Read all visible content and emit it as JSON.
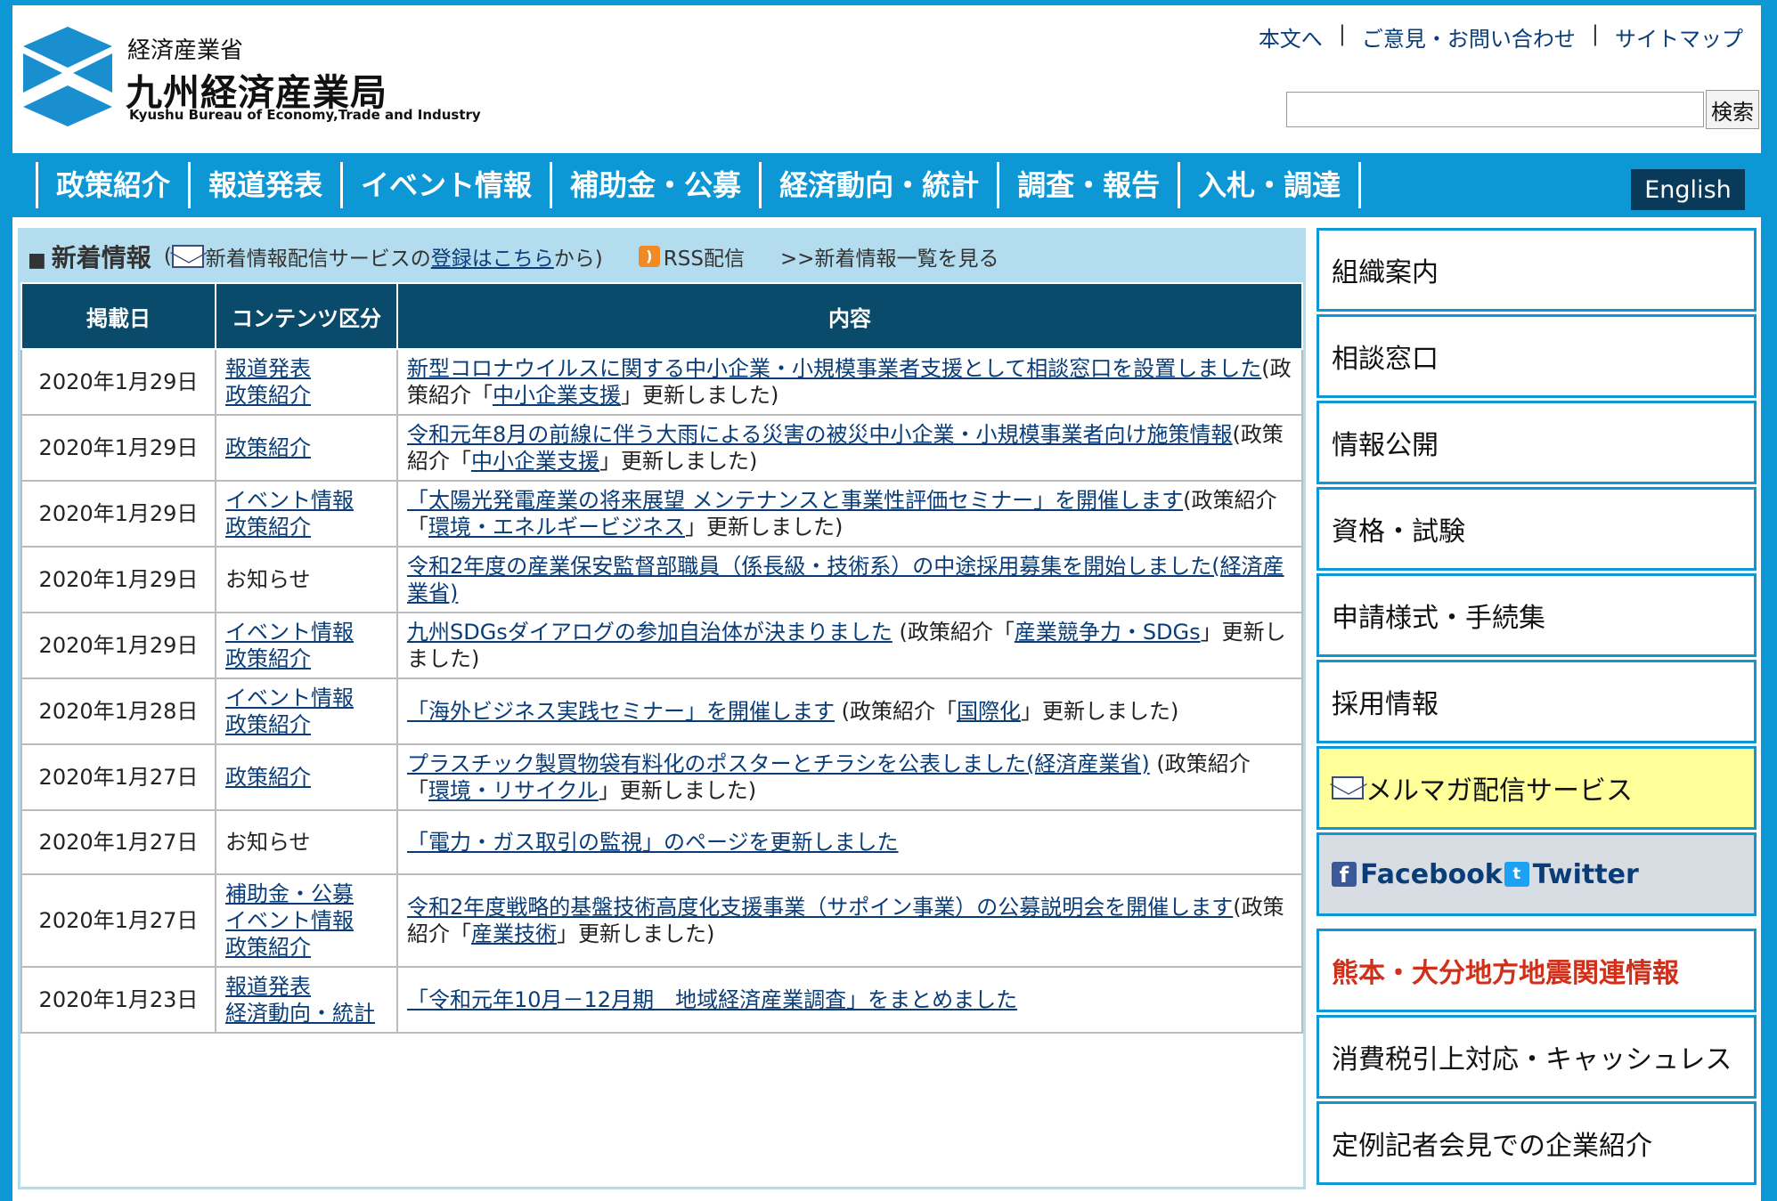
{
  "header": {
    "ministry": "経済産業省",
    "bureau": "九州経済産業局",
    "bureau_en": "Kyushu Bureau of Economy,Trade and Industry",
    "util_links": [
      "本文へ",
      "ご意見・お問い合わせ",
      "サイトマップ"
    ],
    "search_button": "検索",
    "search_value": ""
  },
  "nav": {
    "items": [
      "政策紹介",
      "報道発表",
      "イベント情報",
      "補助金・公募",
      "経済動向・統計",
      "調査・報告",
      "入札・調達"
    ],
    "english": "English"
  },
  "news": {
    "title": "新着情報",
    "sub_prefix": "(",
    "sub_text": "新着情報配信サービスの",
    "sub_link": "登録はこちら",
    "sub_suffix": "から)",
    "rss_label": "RSS配信",
    "list_link": ">>新着情報一覧を見る",
    "columns": [
      "掲載日",
      "コンテンツ区分",
      "内容"
    ],
    "rows": [
      {
        "date": "2020年1月29日",
        "cats": [
          "報道発表",
          "政策紹介"
        ],
        "link": "新型コロナウイルスに関する中小企業・小規模事業者支援として相談窓口を設置しました",
        "pre": "(政策紹介「",
        "sublink": "中小企業支援",
        "post": "」更新しました)"
      },
      {
        "date": "2020年1月29日",
        "cats": [
          "政策紹介"
        ],
        "link": "令和元年8月の前線に伴う大雨による災害の被災中小企業・小規模事業者向け施策情報",
        "pre": "(政策紹介「",
        "sublink": "中小企業支援",
        "post": "」更新しました)"
      },
      {
        "date": "2020年1月29日",
        "cats": [
          "イベント情報",
          "政策紹介"
        ],
        "link": "「太陽光発電産業の将来展望 メンテナンスと事業性評価セミナー」を開催します",
        "pre": "(政策紹介「",
        "sublink": "環境・エネルギービジネス",
        "post": "」更新しました)"
      },
      {
        "date": "2020年1月29日",
        "cats_text": "お知らせ",
        "link": "令和2年度の産業保安監督部職員（係長級・技術系）の中途採用募集を開始しました(経済産業省)"
      },
      {
        "date": "2020年1月29日",
        "cats": [
          "イベント情報",
          "政策紹介"
        ],
        "link": "九州SDGsダイアログの参加自治体が決まりました",
        "pre": " (政策紹介「",
        "sublink": "産業競争力・SDGs",
        "post": "」更新しました)"
      },
      {
        "date": "2020年1月28日",
        "cats": [
          "イベント情報",
          "政策紹介"
        ],
        "link": "「海外ビジネス実践セミナー」を開催します",
        "pre": " (政策紹介「",
        "sublink": "国際化",
        "post": "」更新しました)"
      },
      {
        "date": "2020年1月27日",
        "cats": [
          "政策紹介"
        ],
        "link": "プラスチック製買物袋有料化のポスターとチラシを公表しました(経済産業省)",
        "pre": " (政策紹介「",
        "sublink": "環境・リサイクル",
        "post": "」更新しました)"
      },
      {
        "date": "2020年1月27日",
        "cats_text": "お知らせ",
        "link": "「電力・ガス取引の監視」のページを更新しました"
      },
      {
        "date": "2020年1月27日",
        "cats": [
          "補助金・公募",
          "イベント情報",
          "政策紹介"
        ],
        "link": "令和2年度戦略的基盤技術高度化支援事業（サポイン事業）の公募説明会を開催します",
        "pre": "(政策紹介「",
        "sublink": "産業技術",
        "post": "」更新しました)"
      },
      {
        "date": "2020年1月23日",
        "cats": [
          "報道発表",
          "経済動向・統計"
        ],
        "link": "「令和元年10月－12月期　地域経済産業調査」をまとめました"
      }
    ]
  },
  "sidebar": {
    "items": [
      "組織案内",
      "相談窓口",
      "情報公開",
      "資格・試験",
      "申請様式・手続集",
      "採用情報"
    ],
    "mailmag": "メルマガ配信サービス",
    "facebook": "Facebook",
    "twitter": "Twitter",
    "quake": "熊本・大分地方地震関連情報",
    "tax": "消費税引上対応・キャッシュレス",
    "press": "定例記者会見での企業紹介"
  },
  "colors": {
    "accent": "#0e97d5",
    "table_header": "#0a4a6a",
    "news_head_bg": "#b3dcef",
    "quake_red": "#d0301a"
  }
}
